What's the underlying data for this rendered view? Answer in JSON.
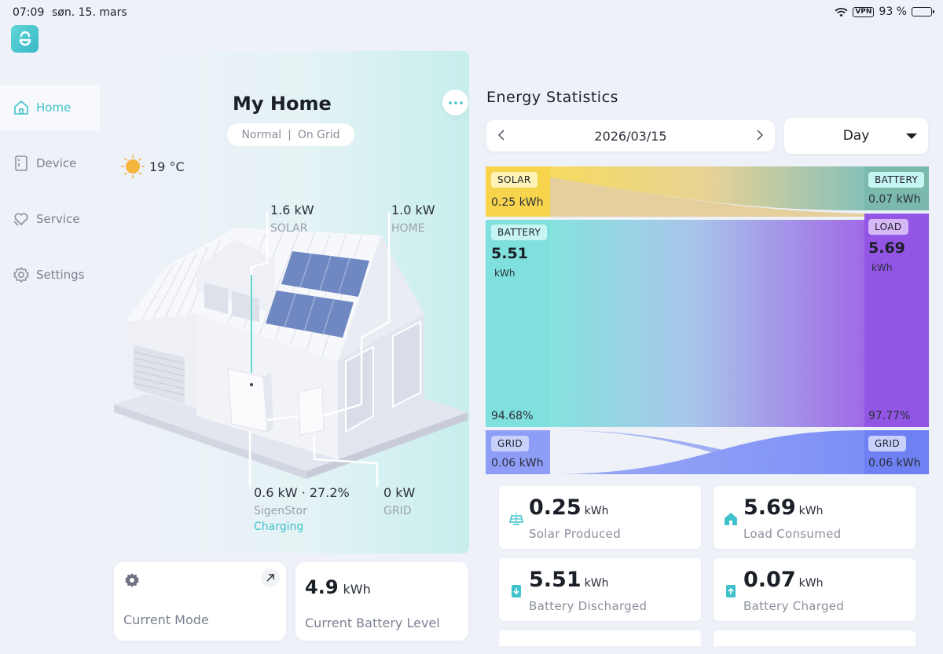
{
  "status_bar": {
    "time": "07:09",
    "date": "søn. 15. mars",
    "vpn": "VPN",
    "battery_pct": "93 %"
  },
  "sidebar": {
    "items": [
      {
        "label": "Home",
        "icon": "home-icon",
        "active": true
      },
      {
        "label": "Device",
        "icon": "device-icon",
        "active": false
      },
      {
        "label": "Service",
        "icon": "service-icon",
        "active": false
      },
      {
        "label": "Settings",
        "icon": "gear-icon",
        "active": false
      }
    ]
  },
  "home": {
    "title": "My Home",
    "mode": "Normal",
    "separator": "|",
    "grid_status": "On Grid",
    "weather_temp": "19 °C",
    "solar": {
      "value": "1.6 kW",
      "label": "SOLAR"
    },
    "home_load": {
      "value": "1.0 kW",
      "label": "HOME"
    },
    "storage": {
      "value": "0.6 kW · 27.2%",
      "label": "SigenStor",
      "status": "Charging"
    },
    "grid": {
      "value": "0 kW",
      "label": "GRID"
    }
  },
  "cards": {
    "current_mode_label": "Current Mode",
    "battery_level_value": "4.9",
    "battery_level_unit": "kWh",
    "battery_level_label": "Current Battery Level"
  },
  "energy": {
    "title": "Energy Statistics",
    "date": "2026/03/15",
    "period": "Day",
    "sankey": {
      "src_solar": {
        "label": "SOLAR",
        "value": "0.25",
        "unit": "kWh"
      },
      "src_battery": {
        "label": "BATTERY",
        "value": "5.51",
        "unit": "kWh",
        "pct": "94.68%"
      },
      "src_grid": {
        "label": "GRID",
        "value": "0.06",
        "unit": "kWh"
      },
      "dst_battery": {
        "label": "BATTERY",
        "value": "0.07",
        "unit": "kWh"
      },
      "dst_load": {
        "label": "LOAD",
        "value": "5.69",
        "unit": "kWh",
        "pct": "97.77%"
      },
      "dst_grid": {
        "label": "GRID",
        "value": "0.06",
        "unit": "kWh"
      }
    },
    "stats": [
      {
        "value": "0.25",
        "unit": "kWh",
        "label": "Solar Produced",
        "icon": "solar-panel-icon"
      },
      {
        "value": "5.69",
        "unit": "kWh",
        "label": "Load Consumed",
        "icon": "house-icon"
      },
      {
        "value": "5.51",
        "unit": "kWh",
        "label": "Battery Discharged",
        "icon": "battery-discharge-icon"
      },
      {
        "value": "0.07",
        "unit": "kWh",
        "label": "Battery Charged",
        "icon": "battery-charge-icon"
      }
    ]
  },
  "colors": {
    "accent": "#3fc2cb",
    "solar": "#f7d44c",
    "battery": "#7fe0dd",
    "load": "#9a5be6",
    "grid": "#7d8ff5"
  }
}
